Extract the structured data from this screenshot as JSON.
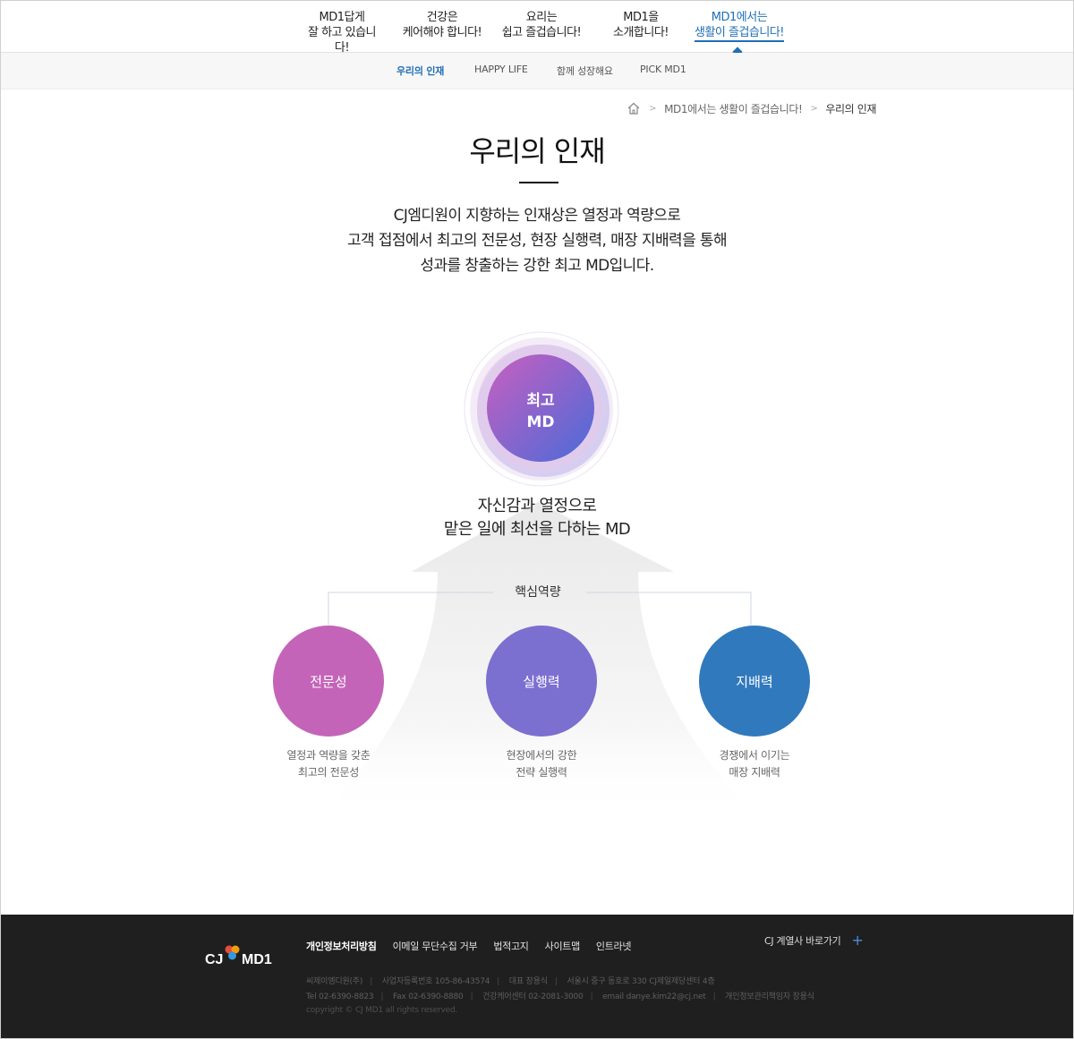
{
  "gnb": {
    "items": [
      {
        "line1": "MD1답게",
        "line2": "잘 하고 있습니다!"
      },
      {
        "line1": "건강은",
        "line2": "케어해야 합니다!"
      },
      {
        "line1": "요리는",
        "line2": "쉽고 즐겁습니다!"
      },
      {
        "line1": "MD1을",
        "line2": "소개합니다!"
      },
      {
        "line1": "MD1에서는",
        "line2": "생활이 즐겁습니다!"
      }
    ],
    "active_index": 4,
    "active_color": "#1f6fb5"
  },
  "lnb": {
    "items": [
      "우리의 인재",
      "HAPPY LIFE",
      "함께 성장해요",
      "PICK MD1"
    ],
    "active_index": 0
  },
  "breadcrumb": {
    "home_icon": "home-icon",
    "items": [
      "MD1에서는 생활이 즐겁습니다!",
      "우리의 인재"
    ]
  },
  "page": {
    "title": "우리의 인재",
    "intro": [
      "CJ엠디원이 지향하는 인재상은 열정과 역량으로",
      "고객 접점에서 최고의 전문성, 현장 실행력, 매장 지배력을 통해",
      "성과를 창출하는 강한 최고 MD입니다."
    ]
  },
  "diagram": {
    "center": {
      "line1": "최고",
      "line2": "MD"
    },
    "center_desc": [
      "자신감과 열정으로",
      "맡은 일에 최선을 다하는 MD"
    ],
    "core_label": "핵심역량",
    "competencies": [
      {
        "name": "전문성",
        "desc": [
          "열정과 역량을 갖춘",
          "최고의 전문성"
        ],
        "color": "#c464b8"
      },
      {
        "name": "실행력",
        "desc": [
          "현장에서의 강한",
          "전략 실행력"
        ],
        "color": "#7b6fd0"
      },
      {
        "name": "지배력",
        "desc": [
          "경쟁에서 이기는",
          "매장 지배력"
        ],
        "color": "#3179bd"
      }
    ]
  },
  "footer": {
    "logo_text": "MD1",
    "logo_prefix": "CJ",
    "links": [
      "개인정보처리방침",
      "이메일 무단수집 거부",
      "법적고지",
      "사이트맵",
      "인트라넷"
    ],
    "family_site": "CJ 계열사 바로가기",
    "info_row1": [
      "씨제이엠디원(주)",
      "사업자등록번호 105-86-43574",
      "대표 장용식",
      "서울시 중구 동호로 330 CJ제일제당센터 4층"
    ],
    "info_row2": [
      "Tel 02-6390-8823",
      "Fax 02-6390-8880",
      "건강케어센터 02-2081-3000",
      "email danye.kim22@cj.net",
      "개인정보관리책임자 장용식"
    ],
    "copyright": "copyright © CJ MD1 all rights reserved."
  }
}
